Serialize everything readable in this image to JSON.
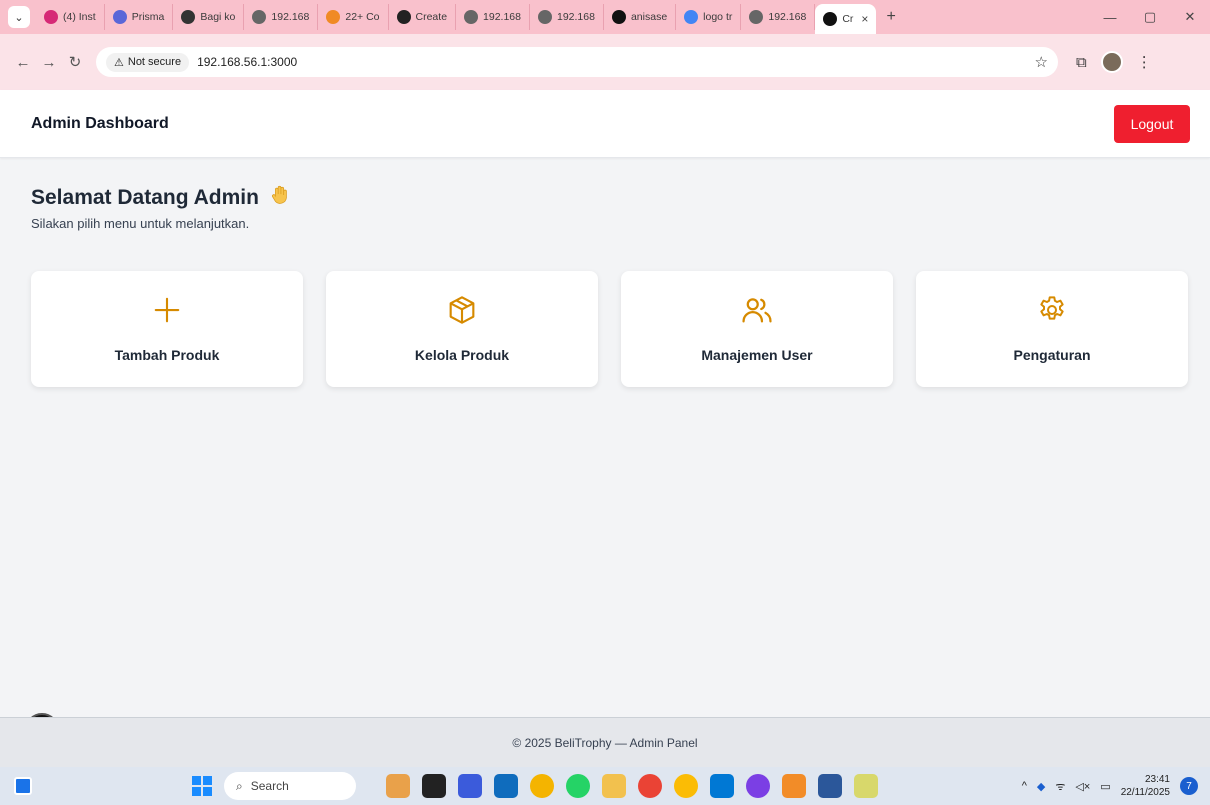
{
  "browser": {
    "tabs": [
      {
        "label": "(4) Inst",
        "color": "#d62976"
      },
      {
        "label": "Prisma",
        "color": "#5a67d8"
      },
      {
        "label": "Bagi ko",
        "color": "#333333"
      },
      {
        "label": "192.168",
        "color": "#666666"
      },
      {
        "label": "22+ Co",
        "color": "#f08a24"
      },
      {
        "label": "Create",
        "color": "#222222"
      },
      {
        "label": "192.168",
        "color": "#666666"
      },
      {
        "label": "192.168",
        "color": "#666666"
      },
      {
        "label": "anisase",
        "color": "#111111"
      },
      {
        "label": "logo tr",
        "color": "#4285f4"
      },
      {
        "label": "192.168",
        "color": "#666666"
      }
    ],
    "active_tab": {
      "label": "Cr",
      "close": "×"
    },
    "new_tab": "+",
    "window_controls": {
      "minimize": "—",
      "restore": "▢",
      "close": "✕"
    },
    "security_label": "Not secure",
    "url": "192.168.56.1:3000"
  },
  "app": {
    "title": "Admin Dashboard",
    "logout_label": "Logout",
    "welcome_title": "Selamat Datang Admin",
    "welcome_subtitle": "Silakan pilih menu untuk melanjutkan.",
    "cards": [
      {
        "label": "Tambah Produk",
        "icon": "plus-icon"
      },
      {
        "label": "Kelola Produk",
        "icon": "package-icon"
      },
      {
        "label": "Manajemen User",
        "icon": "users-icon"
      },
      {
        "label": "Pengaturan",
        "icon": "gear-icon"
      }
    ],
    "footer_text": "© 2025 BeliTrophy — Admin Panel",
    "next_badge": "N",
    "accent_color": "#d68a00",
    "logout_color": "#ef1f2f"
  },
  "taskbar": {
    "search_placeholder": "Search",
    "time": "23:41",
    "date": "22/11/2025",
    "notifications": "7",
    "tray_wifi": "ᯤ",
    "tray_volume": "◁×"
  }
}
